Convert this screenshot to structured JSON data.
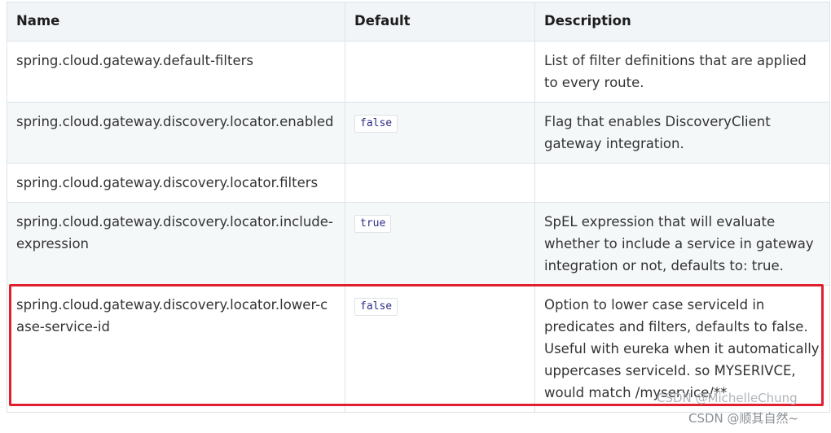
{
  "table": {
    "headers": [
      "Name",
      "Default",
      "Description"
    ],
    "rows": [
      {
        "name": "spring.cloud.gateway.default-filters",
        "default": "",
        "description": "List of filter definitions that are applied to every route."
      },
      {
        "name": "spring.cloud.gateway.discovery.locator.enabled",
        "default": "false",
        "description": "Flag that enables DiscoveryClient gateway integration."
      },
      {
        "name": "spring.cloud.gateway.discovery.locator.filters",
        "default": "",
        "description": ""
      },
      {
        "name": "spring.cloud.gateway.discovery.locator.include-expression",
        "default": "true",
        "description": "SpEL expression that will evaluate whether to include a service in gateway integration or not, defaults to: true."
      },
      {
        "name": "spring.cloud.gateway.discovery.locator.lower-case-service-id",
        "default": "false",
        "description": "Option to lower case serviceId in predicates and filters, defaults to false. Useful with eureka when it automatically uppercases serviceId. so MYSERIVCE, would match /myservice/**"
      }
    ]
  },
  "highlight": {
    "row_index": 4,
    "color": "#e0202e"
  },
  "watermarks": [
    "CSDN @MichelleChung",
    "CSDN @顺其自然~"
  ],
  "colors": {
    "header_bg": "#f1f5f7",
    "stripe_bg": "#f5f8f9",
    "border": "#dde3e8",
    "code_text": "#2d2d8a"
  }
}
